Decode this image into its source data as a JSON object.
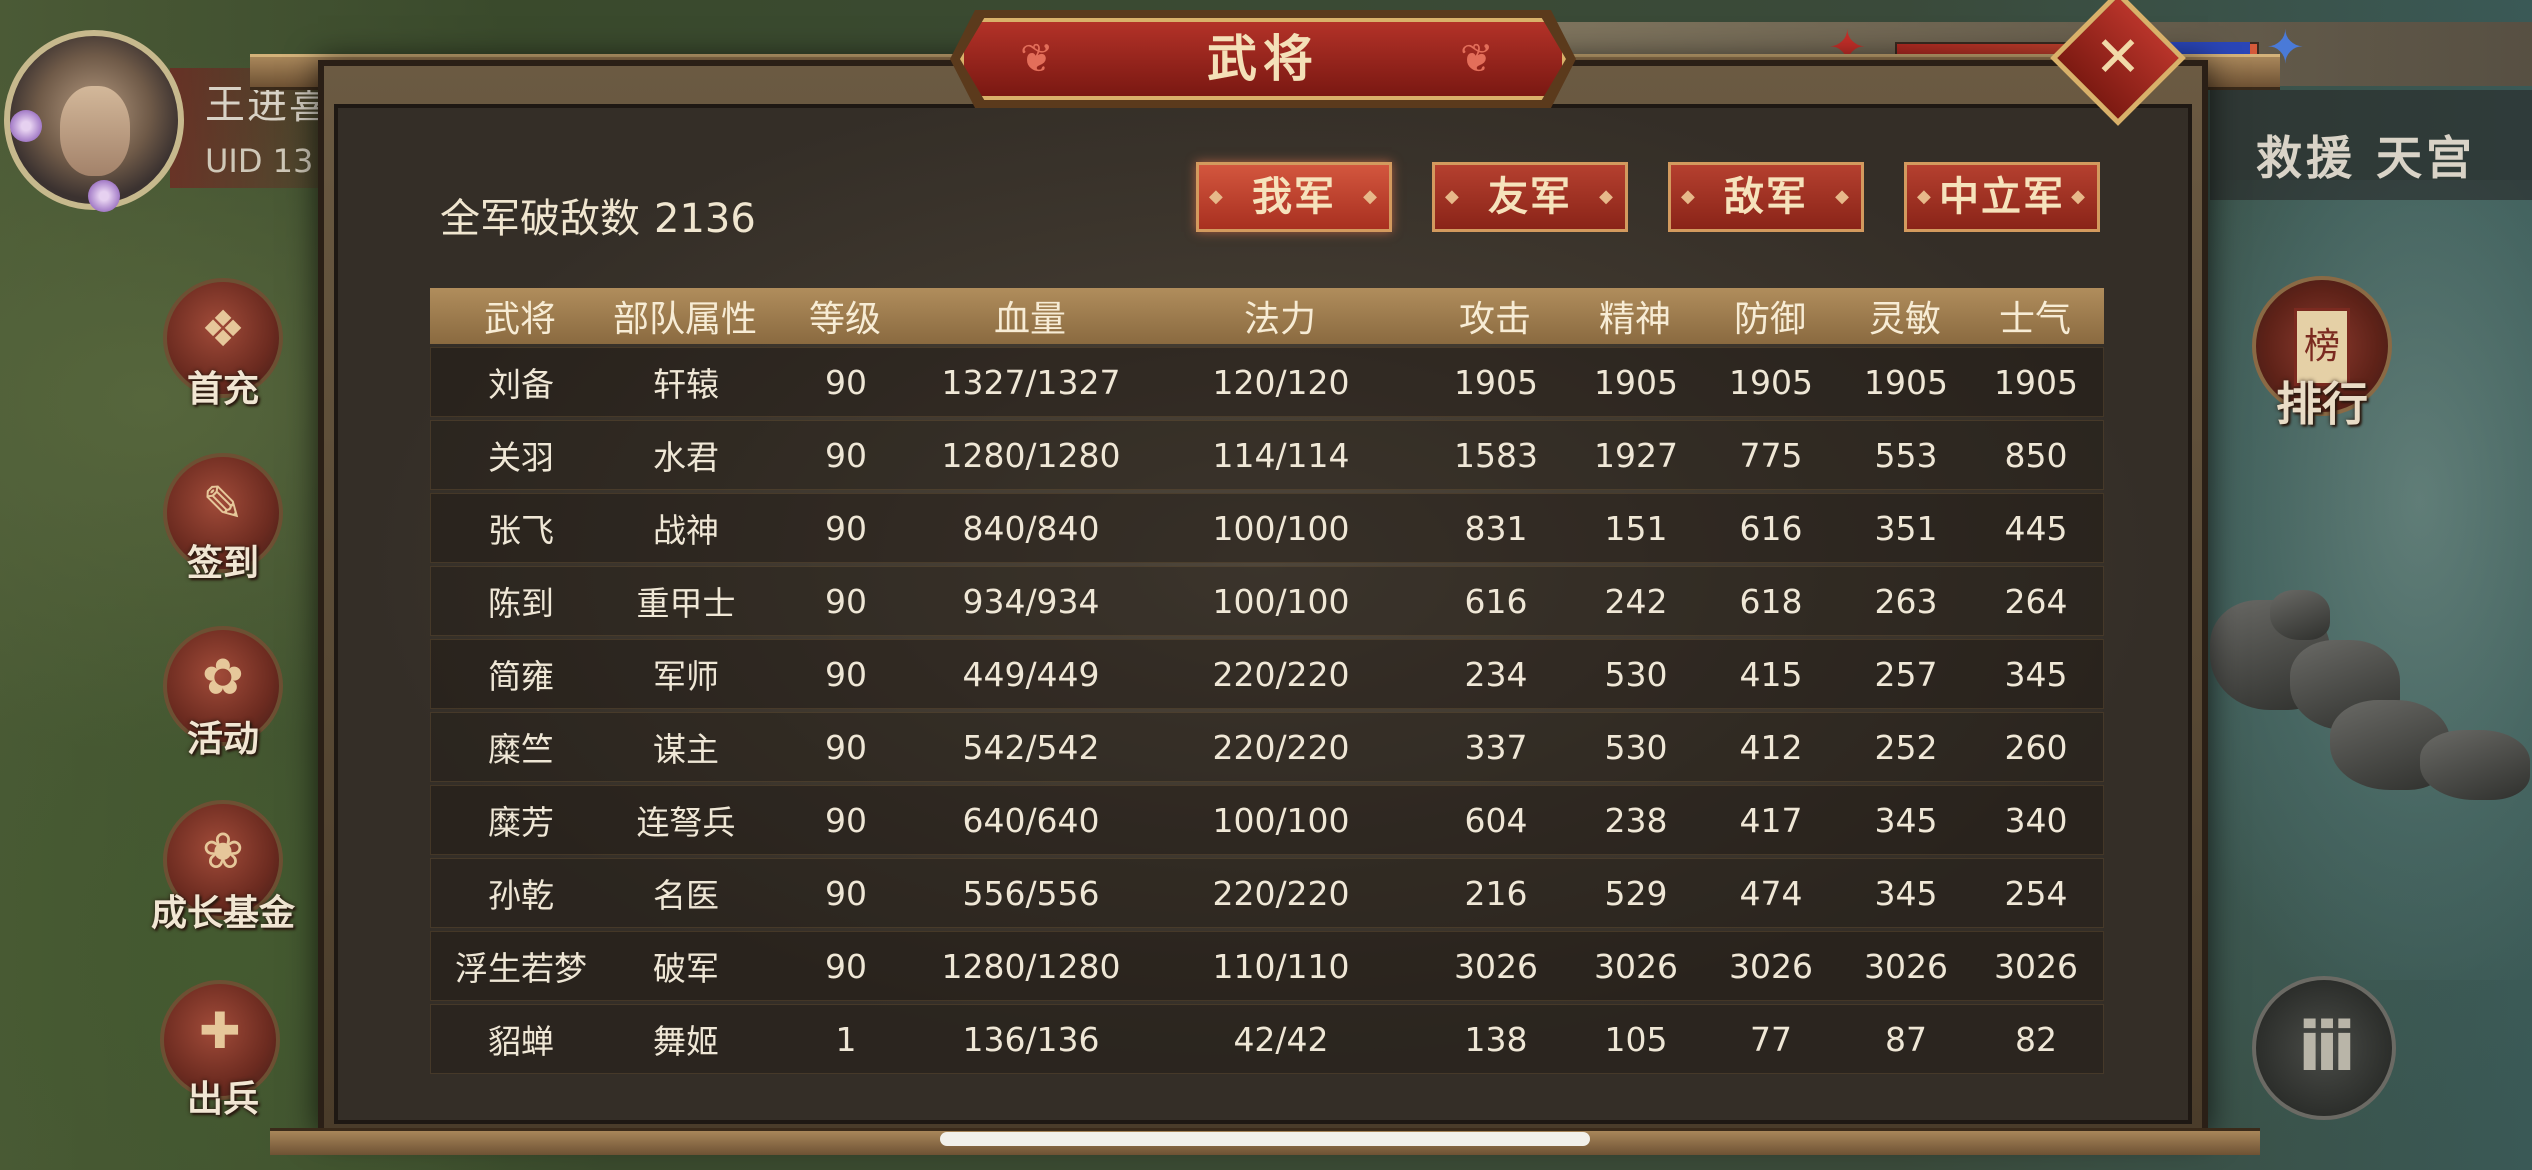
{
  "player": {
    "name": "王进喜",
    "uid": "UID  13"
  },
  "side_menu": [
    {
      "label": "首充",
      "icon": "gift-icon"
    },
    {
      "label": "签到",
      "icon": "book-icon"
    },
    {
      "label": "活动",
      "icon": "treasure-icon"
    },
    {
      "label": "成长基金",
      "icon": "plant-icon"
    },
    {
      "label": "出兵",
      "icon": "flag-icon"
    }
  ],
  "battle_title": "救援 天宫",
  "rank_label": "排行",
  "rank_glyph": "榜",
  "menu_glyph": "iii",
  "dialog": {
    "title": "武将",
    "close_glyph": "✕",
    "kills_label": "全军破敌数",
    "kills_value": "2136",
    "tabs": [
      "我军",
      "友军",
      "敌军",
      "中立军"
    ],
    "active_tab": "我军"
  },
  "table": {
    "headers": [
      "武将",
      "部队属性",
      "等级",
      "血量",
      "法力",
      "攻击",
      "精神",
      "防御",
      "灵敏",
      "士气"
    ],
    "rows": [
      [
        "刘备",
        "轩辕",
        "90",
        "1327/1327",
        "120/120",
        "1905",
        "1905",
        "1905",
        "1905",
        "1905"
      ],
      [
        "关羽",
        "水君",
        "90",
        "1280/1280",
        "114/114",
        "1583",
        "1927",
        "775",
        "553",
        "850"
      ],
      [
        "张飞",
        "战神",
        "90",
        "840/840",
        "100/100",
        "831",
        "151",
        "616",
        "351",
        "445"
      ],
      [
        "陈到",
        "重甲士",
        "90",
        "934/934",
        "100/100",
        "616",
        "242",
        "618",
        "263",
        "264"
      ],
      [
        "简雍",
        "军师",
        "90",
        "449/449",
        "220/220",
        "234",
        "530",
        "415",
        "257",
        "345"
      ],
      [
        "糜竺",
        "谋主",
        "90",
        "542/542",
        "220/220",
        "337",
        "530",
        "412",
        "252",
        "260"
      ],
      [
        "糜芳",
        "连弩兵",
        "90",
        "640/640",
        "100/100",
        "604",
        "238",
        "417",
        "345",
        "340"
      ],
      [
        "孙乾",
        "名医",
        "90",
        "556/556",
        "220/220",
        "216",
        "529",
        "474",
        "345",
        "254"
      ],
      [
        "浮生若梦",
        "破军",
        "90",
        "1280/1280",
        "110/110",
        "3026",
        "3026",
        "3026",
        "3026",
        "3026"
      ],
      [
        "貂蝉",
        "舞姬",
        "1",
        "136/136",
        "42/42",
        "138",
        "105",
        "77",
        "87",
        "82"
      ]
    ]
  },
  "colors": {
    "tab_red": "#a83020",
    "gold_trim": "#d9b16a",
    "hp": "#b32a22",
    "mp": "#2a46b8"
  }
}
